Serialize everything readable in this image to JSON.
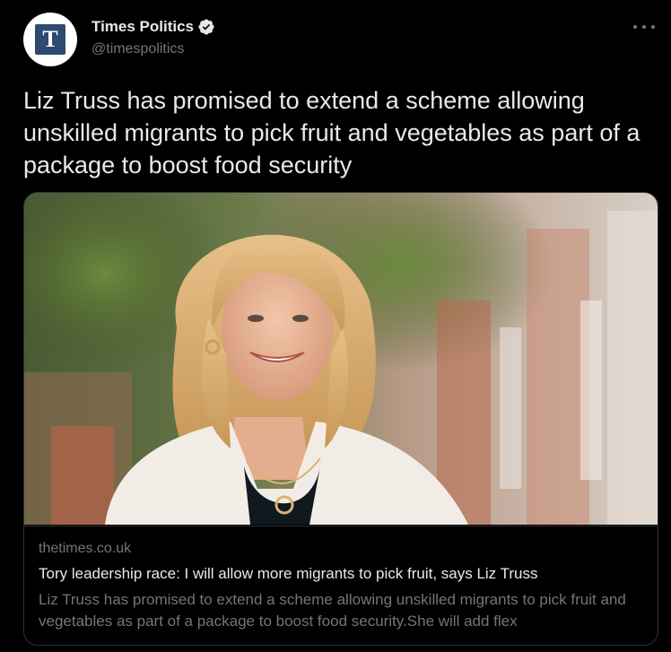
{
  "account": {
    "display_name": "Times Politics",
    "handle": "@timespolitics",
    "avatar_letter": "T",
    "verified_icon": "verified-badge-icon",
    "avatar_color": "#2d4b70"
  },
  "tweet": {
    "text": "Liz Truss has promised to extend a scheme allowing unskilled migrants to pick fruit and vegetables as part of a package to boost food security"
  },
  "more_icon": "more-options-icon",
  "card": {
    "image_icon": "article-photo",
    "domain": "thetimes.co.uk",
    "title": "Tory leadership race: I will allow more migrants to pick fruit, says Liz Truss",
    "description": "Liz Truss has promised to extend a scheme allowing unskilled migrants to pick fruit and vegetables as part of a package to boost food security.She will add flex"
  },
  "colors": {
    "background": "#000000",
    "primary_text": "#e7e9ea",
    "secondary_text": "#71767b",
    "border": "#2f3336"
  }
}
